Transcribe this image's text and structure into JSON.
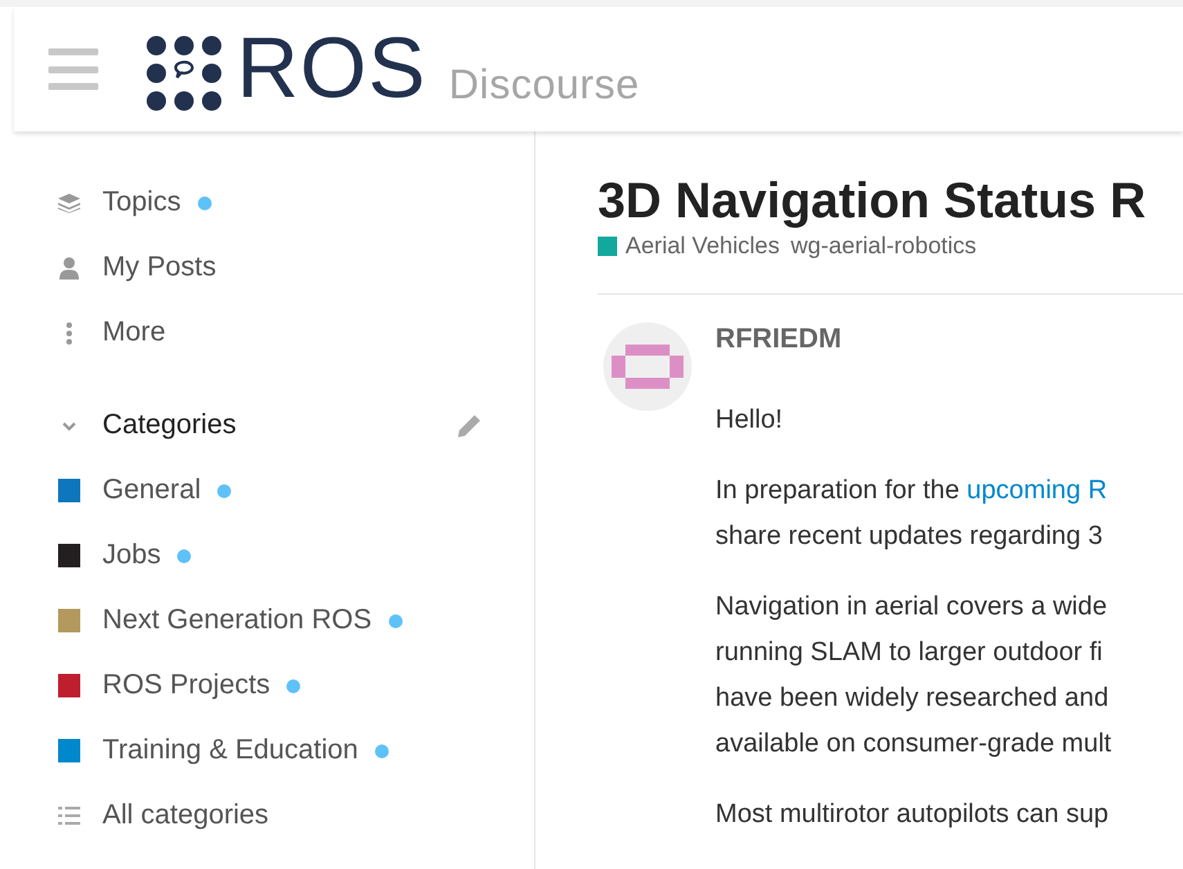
{
  "header": {
    "logo_text": "ROS",
    "logo_subtitle": "Discourse"
  },
  "sidebar": {
    "items": [
      {
        "kind": "topics",
        "label": "Topics",
        "unread": true
      },
      {
        "kind": "posts",
        "label": "My Posts",
        "unread": false
      },
      {
        "kind": "more",
        "label": "More",
        "unread": false
      }
    ],
    "categories_heading": {
      "label": "Categories",
      "expanded": true
    },
    "categories": [
      {
        "label": "General",
        "color": "#0e76bd",
        "unread": true
      },
      {
        "label": "Jobs",
        "color": "#231f20",
        "unread": true
      },
      {
        "label": "Next Generation ROS",
        "color": "#b3995d",
        "unread": true
      },
      {
        "label": "ROS Projects",
        "color": "#bf1e2e",
        "unread": true
      },
      {
        "label": "Training & Education",
        "color": "#0088cc",
        "unread": true
      }
    ],
    "all_categories": "All categories"
  },
  "topic": {
    "title": "3D Navigation Status R",
    "category": {
      "label": "Aerial Vehicles",
      "color": "#12a89d"
    },
    "tag": "wg-aerial-robotics",
    "post": {
      "author": "RFRIEDM",
      "paragraphs": [
        [
          [
            {
              "text": "Hello!",
              "link": false
            }
          ]
        ],
        [
          [
            {
              "text": "In preparation for the ",
              "link": false
            },
            {
              "text": "upcoming R",
              "link": true
            }
          ],
          [
            {
              "text": "share recent updates regarding 3",
              "link": false
            }
          ]
        ],
        [
          [
            {
              "text": "Navigation in aerial covers a wide",
              "link": false
            }
          ],
          [
            {
              "text": "running SLAM to larger outdoor fi",
              "link": false
            }
          ],
          [
            {
              "text": "have been widely researched and",
              "link": false
            }
          ],
          [
            {
              "text": "available on consumer-grade mult",
              "link": false
            }
          ]
        ],
        [
          [
            {
              "text": "Most multirotor autopilots can sup",
              "link": false
            }
          ]
        ]
      ]
    }
  }
}
